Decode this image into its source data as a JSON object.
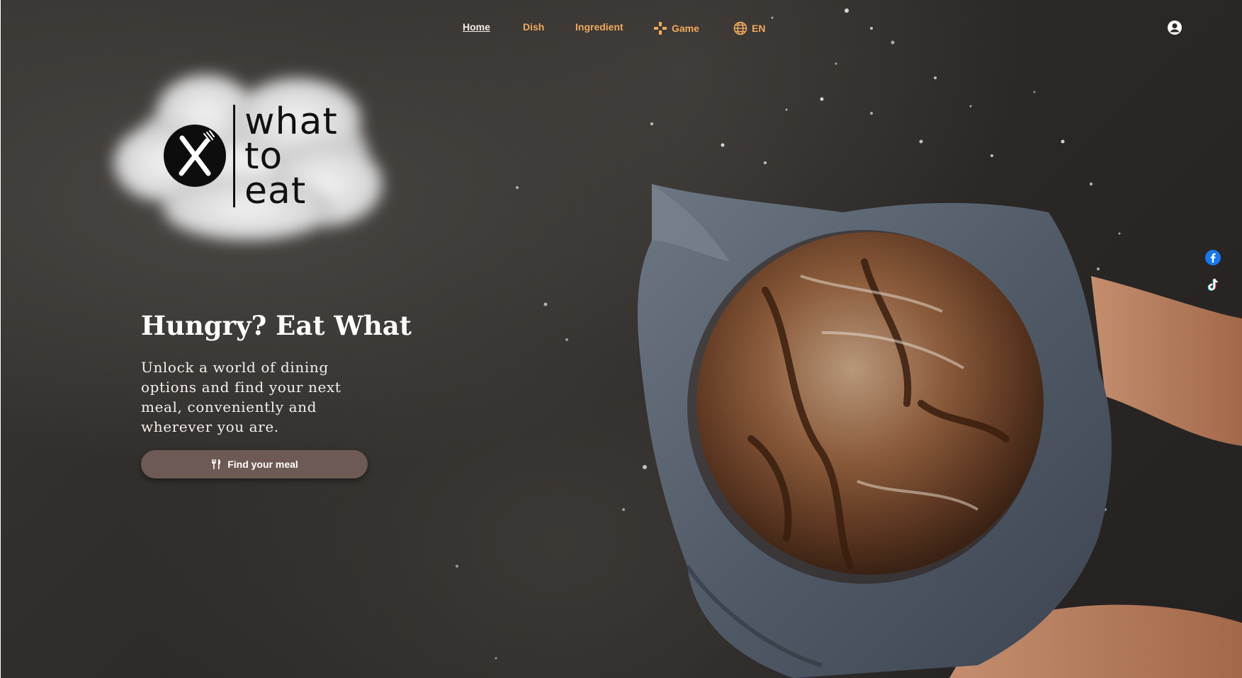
{
  "nav": {
    "items": [
      {
        "label": "Home",
        "active": true
      },
      {
        "label": "Dish",
        "active": false
      },
      {
        "label": "Ingredient",
        "active": false
      },
      {
        "label": "Game",
        "icon": "gamepad-icon",
        "active": false
      },
      {
        "label": "EN",
        "icon": "globe-icon",
        "active": false
      }
    ],
    "profile_icon": "user-circle-icon"
  },
  "logo": {
    "line1": "what",
    "line2": "to",
    "line3": "eat",
    "icon": "fork-knife-icon"
  },
  "hero": {
    "title": "Hungry? Eat What",
    "text": "Unlock a world of dining options and find your next meal, conveniently and wherever you are.",
    "cta_label": "Find your meal",
    "cta_icon": "utensils-icon"
  },
  "social": {
    "icons": [
      "facebook-icon",
      "tiktok-icon"
    ]
  },
  "colors": {
    "nav_link": "#f0a85c",
    "nav_active": "#f4ece6",
    "cta_bg": "#6e5a54",
    "background": "#2b2826",
    "facebook": "#1877f2"
  }
}
